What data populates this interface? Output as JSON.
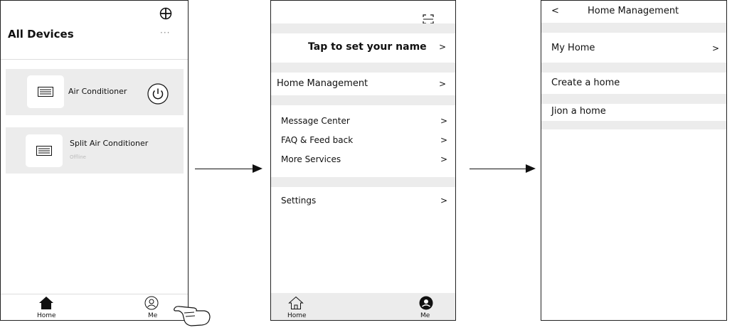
{
  "screen1": {
    "title": "All Devices",
    "more_label": "···",
    "devices": [
      {
        "name": "Air Conditioner",
        "status": ""
      },
      {
        "name": "Split Air Conditioner",
        "status": "Offline"
      }
    ],
    "tabbar": {
      "home": "Home",
      "me": "Me"
    }
  },
  "screen2": {
    "name_prompt": "Tap to set your name",
    "home_management": "Home Management",
    "menu": [
      "Message Center",
      "FAQ & Feed back",
      "More Services"
    ],
    "settings": "Settings",
    "chevron": ">",
    "tabbar": {
      "home": "Home",
      "me": "Me"
    }
  },
  "screen3": {
    "back": "<",
    "title": "Home Management",
    "my_home": "My Home",
    "chevron": ">",
    "create_home": "Create a home",
    "join_home": "Jion a home"
  }
}
